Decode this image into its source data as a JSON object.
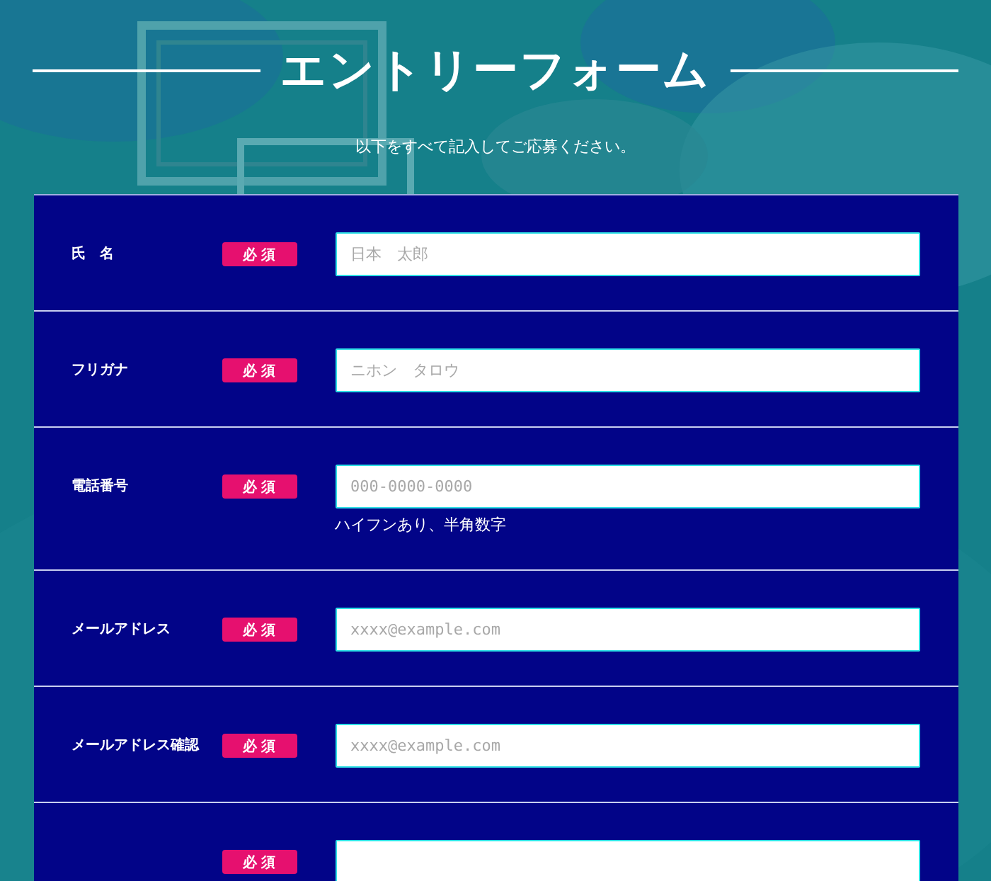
{
  "header": {
    "title": "エントリーフォーム",
    "subtitle": "以下をすべて記入してご応募ください。"
  },
  "fields": [
    {
      "label": "氏　名",
      "badge": "必 須",
      "placeholder": "日本　太郎"
    },
    {
      "label": "フリガナ",
      "badge": "必 須",
      "placeholder": "ニホン　タロウ"
    },
    {
      "label": "電話番号",
      "badge": "必 須",
      "placeholder": "000-0000-0000",
      "note": "ハイフンあり、半角数字"
    },
    {
      "label": "メールアドレス",
      "badge": "必 須",
      "placeholder": "xxxx@example.com"
    },
    {
      "label": "メールアドレス確認",
      "badge": "必 須",
      "placeholder": "xxxx@example.com"
    },
    {
      "badge": "必 須"
    }
  ]
}
